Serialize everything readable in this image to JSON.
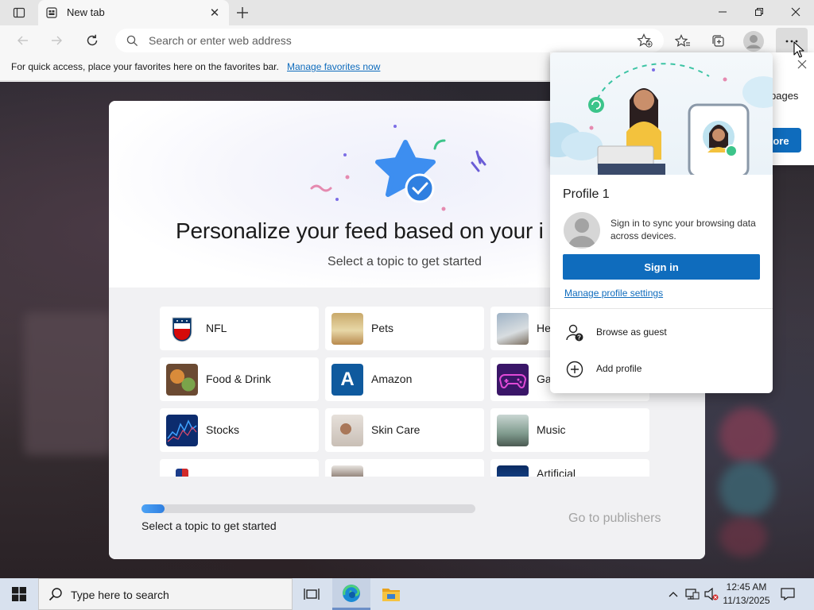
{
  "browser": {
    "tab": {
      "title": "New tab",
      "favicon": "new-tab-page-icon"
    },
    "window_controls": [
      "minimize",
      "restore",
      "close"
    ],
    "address_bar": {
      "value": "",
      "placeholder": "Search or enter web address"
    },
    "favorites_bar": {
      "message": "For quick access, place your favorites here on the favorites bar.",
      "link": "Manage favorites now"
    }
  },
  "personalize_card": {
    "heading": "Personalize your feed based on your i",
    "subheading": "Select a topic to get started",
    "topics": [
      {
        "label": "NFL",
        "icon": "nfl-logo"
      },
      {
        "label": "Pets",
        "icon": "pets-photo"
      },
      {
        "label": "He",
        "icon": "health-photo"
      },
      {
        "label": "Food & Drink",
        "icon": "food-photo"
      },
      {
        "label": "Amazon",
        "icon": "amazon-letter-a"
      },
      {
        "label": "Ga",
        "icon": "gaming-controller"
      },
      {
        "label": "Stocks",
        "icon": "stocks-chart"
      },
      {
        "label": "Skin Care",
        "icon": "skincare-photo"
      },
      {
        "label": "Music",
        "icon": "music-photo"
      },
      {
        "label": "",
        "icon": "mlb-logo"
      },
      {
        "label": "",
        "icon": "photo"
      },
      {
        "label": "Artificial",
        "icon": "ai-photo"
      }
    ],
    "progress": {
      "label": "Select a topic to get started",
      "fraction": 0.07
    },
    "go_to_publishers": "Go to publishers"
  },
  "background_notice": {
    "text_fragment": "pages",
    "button_fragment": "tore"
  },
  "profile_flyout": {
    "title": "Profile 1",
    "sync_text": "Sign in to sync your browsing data across devices.",
    "sign_in": "Sign in",
    "manage_link": "Manage profile settings",
    "items": [
      {
        "label": "Browse as guest",
        "icon": "guest-icon"
      },
      {
        "label": "Add profile",
        "icon": "add-circle-icon"
      }
    ]
  },
  "taskbar": {
    "search_placeholder": "Type here to search",
    "time": "12:45 AM",
    "date": "11/13/2025"
  },
  "colors": {
    "accent": "#0f6cbd",
    "taskbar": "#d8e1ee",
    "progress_fill": "#2f7fe0"
  }
}
